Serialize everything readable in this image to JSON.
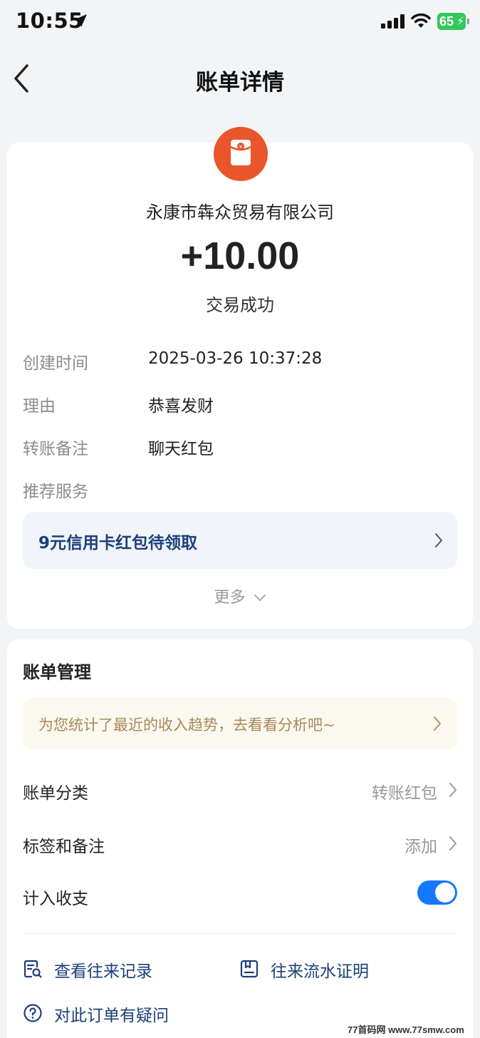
{
  "status_bar": {
    "time": "10:55",
    "battery": "65"
  },
  "nav": {
    "title": "账单详情"
  },
  "transaction": {
    "merchant": "永康市犇众贸易有限公司",
    "amount": "+10.00",
    "status": "交易成功",
    "details": [
      {
        "label": "创建时间",
        "value": "2025-03-26 10:37:28"
      },
      {
        "label": "理由",
        "value": "恭喜发财"
      },
      {
        "label": "转账备注",
        "value": "聊天红包"
      },
      {
        "label": "推荐服务",
        "value": ""
      }
    ],
    "promo": "9元信用卡红包待领取",
    "more": "更多"
  },
  "management": {
    "title": "账单管理",
    "insight": "为您统计了最近的收入趋势，去看看分析吧~",
    "category_label": "账单分类",
    "category_value": "转账红包",
    "tags_label": "标签和备注",
    "tags_value": "添加",
    "include_label": "计入收支",
    "include_enabled": true,
    "actions": {
      "history": "查看往来记录",
      "proof": "往来流水证明",
      "question": "对此订单有疑问"
    }
  },
  "watermark": "77首码网 www.77smw.com",
  "colors": {
    "accent": "#1677ff",
    "logo": "#e8562a",
    "link": "#1c3f7a"
  }
}
